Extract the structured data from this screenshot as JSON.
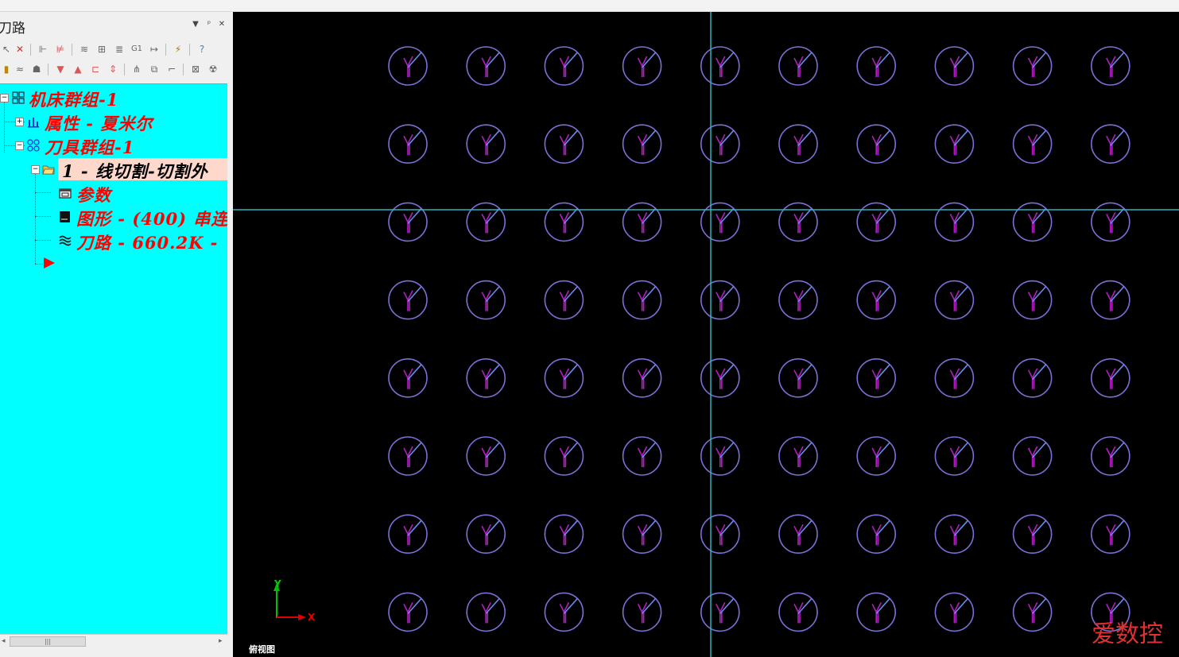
{
  "panel": {
    "title": "刀路",
    "header_controls": [
      "▼",
      "ᵖ",
      "✕"
    ]
  },
  "tree": {
    "items": [
      {
        "label": "机床群组-1",
        "icon": "machine-group-icon"
      },
      {
        "label": "属性 - 夏米尔",
        "icon": "properties-icon"
      },
      {
        "label": "刀具群组-1",
        "icon": "tool-group-icon"
      },
      {
        "label": "1 - 线切割-切割外",
        "icon": "open-folder-icon",
        "selected": true
      },
      {
        "label": "参数",
        "icon": "parameters-icon"
      },
      {
        "label": "图形 - (400) 串连",
        "icon": "geometry-icon"
      },
      {
        "label": "刀路 - 660.2K -",
        "icon": "toolpath-icon"
      }
    ],
    "insert_marker": "insert-arrow-icon"
  },
  "viewport": {
    "view_name": "俯视图",
    "axis_x": "X",
    "axis_y": "Y",
    "watermark": "爱数控",
    "grid": {
      "rows": 8,
      "cols": 10
    },
    "colors": {
      "background": "#000000",
      "circle": "#7b6fd8",
      "y_mark": "#b020c0",
      "line": "#6a8af0",
      "crosshair": "#2ab4c0"
    }
  }
}
